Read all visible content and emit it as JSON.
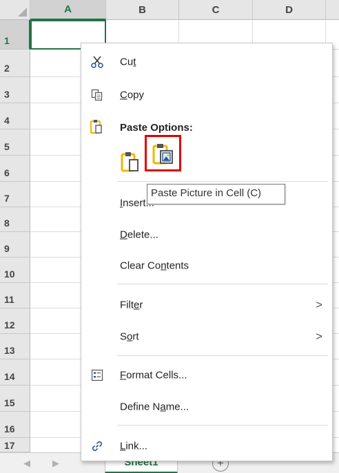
{
  "grid": {
    "columns": [
      "A",
      "B",
      "C",
      "D"
    ],
    "rows": [
      "1",
      "2",
      "3",
      "4",
      "5",
      "6",
      "7",
      "8",
      "9",
      "10",
      "11",
      "12",
      "13",
      "14",
      "15",
      "16",
      "17"
    ],
    "active_cell": "A1"
  },
  "menu": {
    "items": [
      {
        "id": "cut",
        "label_pre": "Cu",
        "accel": "t",
        "label_post": "",
        "icon": "scissors-icon"
      },
      {
        "id": "copy",
        "label_pre": "",
        "accel": "C",
        "label_post": "opy",
        "icon": "copy-icon"
      },
      {
        "id": "insert",
        "label_pre": "",
        "accel": "I",
        "label_post": "nsert...",
        "icon": ""
      },
      {
        "id": "delete",
        "label_pre": "",
        "accel": "D",
        "label_post": "elete...",
        "icon": ""
      },
      {
        "id": "clear",
        "label_pre": "Clear Co",
        "accel": "n",
        "label_post": "tents",
        "icon": ""
      },
      {
        "id": "filter",
        "label_pre": "Filt",
        "accel": "e",
        "label_post": "r",
        "icon": "",
        "submenu": ">"
      },
      {
        "id": "sort",
        "label_pre": "S",
        "accel": "o",
        "label_post": "rt",
        "icon": "",
        "submenu": ">"
      },
      {
        "id": "format",
        "label_pre": "",
        "accel": "F",
        "label_post": "ormat Cells...",
        "icon": "format-cells-icon"
      },
      {
        "id": "define",
        "label_pre": "Define N",
        "accel": "a",
        "label_post": "me...",
        "icon": ""
      },
      {
        "id": "link",
        "label_pre": "",
        "accel": "L",
        "label_post": "ink...",
        "icon": "link-icon"
      }
    ],
    "paste_options_label": "Paste Options:",
    "paste_buttons": [
      "paste-icon",
      "paste-picture-in-cell-icon"
    ],
    "tooltip": "Paste Picture in Cell (C)"
  },
  "tabs": {
    "sheet": "Sheet1",
    "add_label": "+",
    "nav_prev": "◀",
    "nav_next": "▶"
  },
  "colors": {
    "excel_green": "#217346",
    "highlight_red": "#e10000",
    "clipboard_yellow": "#f2b600"
  }
}
